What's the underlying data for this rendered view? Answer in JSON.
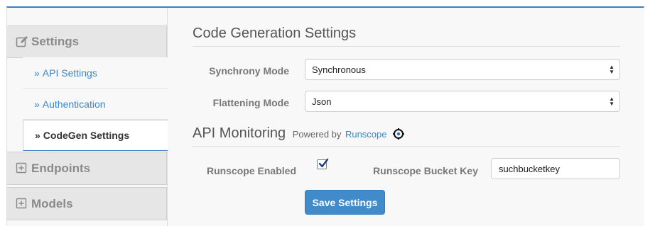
{
  "sidebar": {
    "settings_label": "Settings",
    "items": [
      {
        "label": "API Settings"
      },
      {
        "label": "Authentication"
      },
      {
        "label": "CodeGen Settings"
      }
    ],
    "endpoints_label": "Endpoints",
    "models_label": "Models",
    "chevron": "»"
  },
  "codegen": {
    "title": "Code Generation Settings",
    "synchrony_label": "Synchrony Mode",
    "synchrony_value": "Synchronous",
    "flattening_label": "Flattening Mode",
    "flattening_value": "Json"
  },
  "monitoring": {
    "title": "API Monitoring",
    "powered_by": "Powered by",
    "provider": "Runscope",
    "runscope_enabled_label": "Runscope Enabled",
    "runscope_enabled": true,
    "bucket_key_label": "Runscope Bucket Key",
    "bucket_key_value": "suchbucketkey"
  },
  "actions": {
    "save_label": "Save Settings"
  },
  "colors": {
    "accent": "#428bca",
    "link": "#3a87c8",
    "sidebar_header_bg": "#e6e6e6"
  },
  "icons": {
    "settings": "edit-icon",
    "endpoints": "plus-square-icon",
    "models": "plus-square-icon",
    "runscope": "runscope-logo-icon"
  }
}
